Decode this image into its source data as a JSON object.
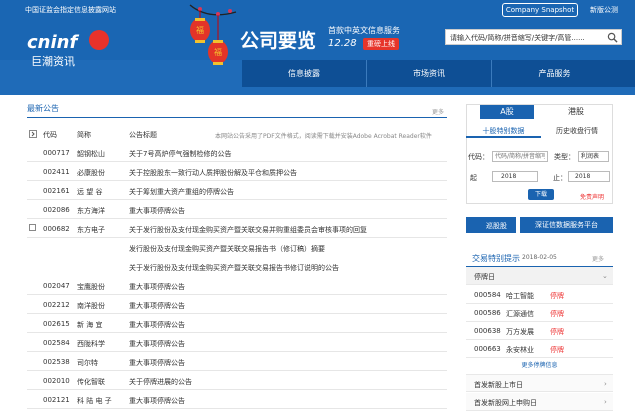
{
  "header": {
    "tagline": "中国证监会指定信息披露网站",
    "snapshot_label": "Company Snapshot",
    "newver_label": "新版公测",
    "logo_en": "cninf",
    "logo_cn": "巨潮资讯",
    "big_title": "公司要览",
    "sub_title": "首款中英文信息服务",
    "date": "12.28",
    "online_badge": "重磅上线",
    "search_placeholder": "请输入代码/简称/拼音缩写/关键字/高管......"
  },
  "nav": {
    "items": [
      "信息披露",
      "市场资讯",
      "产品服务"
    ]
  },
  "announcements": {
    "title": "最新公告",
    "more": "更多",
    "col_code": "代码",
    "col_name": "简称",
    "col_title": "公告标题",
    "notice": "本网站公告采用了PDF文件格式，阅读需下载并安装Adobe Acrobat Reader软件",
    "rows": [
      {
        "code": "000717",
        "name": "韶钢松山",
        "title": "关于7号高炉停气强制检修的公告"
      },
      {
        "code": "002411",
        "name": "必康股份",
        "title": "关于控股股东一致行动人质押股份解及平仓和质押公告"
      },
      {
        "code": "002161",
        "name": "远 望 谷",
        "title": "关于筹划重大资产重组的停牌公告"
      },
      {
        "code": "002086",
        "name": "东方海洋",
        "title": "重大事项停牌公告"
      },
      {
        "code": "000682",
        "name": "东方电子",
        "title": "关于发行股份及支付现金购买资产暨关联交易并购重组委员会审核事项的回复"
      },
      {
        "code": "",
        "name": "",
        "title": "发行股份及支付现金购买资产暨关联交易报告书（修订稿）摘要"
      },
      {
        "code": "",
        "name": "",
        "title": "关于发行股份及支付现金购买资产暨关联交易报告书修订说明的公告"
      },
      {
        "code": "002047",
        "name": "宝鹰股份",
        "title": "重大事项停牌公告"
      },
      {
        "code": "002212",
        "name": "南洋股份",
        "title": "重大事项停牌公告"
      },
      {
        "code": "002615",
        "name": "新 海 宜",
        "title": "重大事项停牌公告"
      },
      {
        "code": "002584",
        "name": "西陇科学",
        "title": "重大事项停牌公告"
      },
      {
        "code": "002538",
        "name": "司尔特",
        "title": "重大事项停牌公告"
      },
      {
        "code": "002010",
        "name": "传化智联",
        "title": "关于停牌进展的公告"
      },
      {
        "code": "002121",
        "name": "科 陆 电 子",
        "title": "重大事项停牌公告"
      }
    ]
  },
  "sidebar": {
    "tab_a": "A股",
    "tab_hk": "港股",
    "subtab_1": "十股特别数据",
    "subtab_2": "历史收盘行情",
    "code_label": "代码：",
    "code_placeholder": "代码/简称/拼音缩写",
    "type_label": "类型：",
    "type_value": "利润表",
    "start_label": "起",
    "start_year": "2018",
    "end_label": "止：",
    "end_year": "2018",
    "download": "下载",
    "disclaimer": "免责声明",
    "banner_left": "巡股股",
    "banner_right": "深证信数据服务平台",
    "tips_title": "交易特别提示",
    "tips_date": "2018-02-05",
    "tips_more": "更多",
    "suspend_label": "停牌日",
    "suspend_rows": [
      {
        "code": "000584",
        "name": "哈工智能",
        "status": "停牌"
      },
      {
        "code": "000586",
        "name": "汇源通信",
        "status": "停牌"
      },
      {
        "code": "000638",
        "name": "万方发展",
        "status": "停牌"
      },
      {
        "code": "000663",
        "name": "永安林业",
        "status": "停牌"
      }
    ],
    "suspend_more": "更多停牌信息",
    "ipo_label": "首发新股上市日",
    "ipo2_label": "首发新股网上申购日"
  }
}
